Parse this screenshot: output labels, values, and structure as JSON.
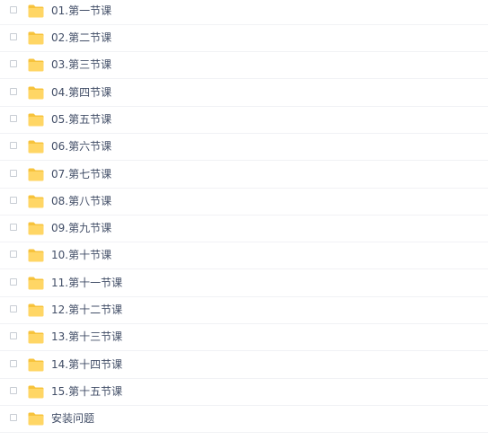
{
  "file_list": {
    "folder_color": "#ffd665",
    "folder_tab_color": "#f7c33c",
    "items": [
      {
        "name": "01.第一节课"
      },
      {
        "name": "02.第二节课"
      },
      {
        "name": "03.第三节课"
      },
      {
        "name": "04.第四节课"
      },
      {
        "name": "05.第五节课"
      },
      {
        "name": "06.第六节课"
      },
      {
        "name": "07.第七节课"
      },
      {
        "name": "08.第八节课"
      },
      {
        "name": "09.第九节课"
      },
      {
        "name": "10.第十节课"
      },
      {
        "name": "11.第十一节课"
      },
      {
        "name": "12.第十二节课"
      },
      {
        "name": "13.第十三节课"
      },
      {
        "name": "14.第十四节课"
      },
      {
        "name": "15.第十五节课"
      },
      {
        "name": "安装问题"
      }
    ]
  }
}
